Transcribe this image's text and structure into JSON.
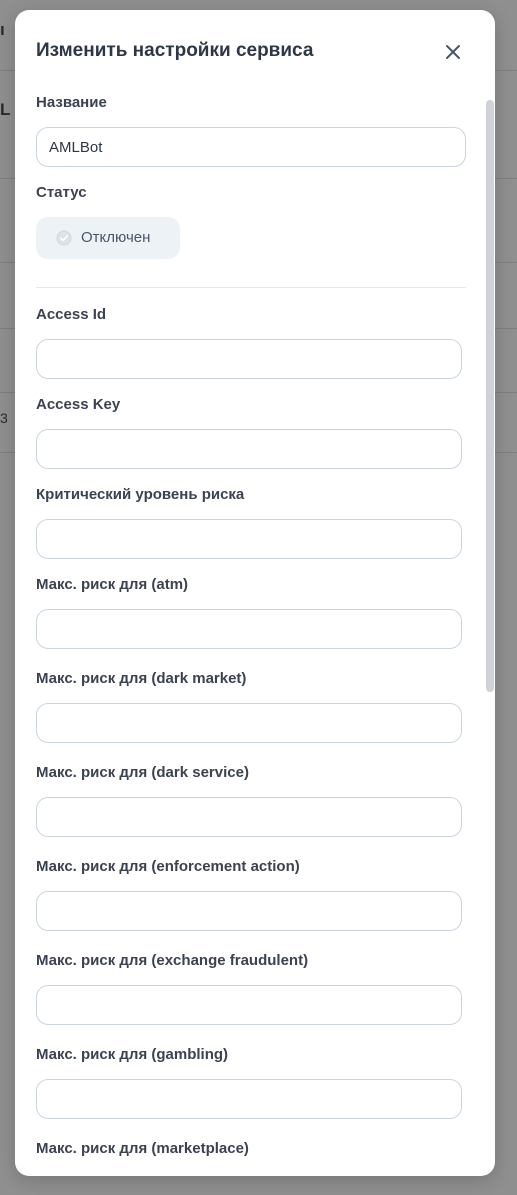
{
  "modal": {
    "title": "Изменить настройки сервиса"
  },
  "form": {
    "name": {
      "label": "Название",
      "value": "AMLBot"
    },
    "status": {
      "label": "Статус",
      "value": "Отключен"
    },
    "fields": [
      {
        "label": "Access Id",
        "value": ""
      },
      {
        "label": "Access Key",
        "value": ""
      },
      {
        "label": "Критический уровень риска",
        "value": ""
      },
      {
        "label": "Макс. риск для (atm)",
        "value": ""
      },
      {
        "label": "Макс. риск для (dark market)",
        "value": ""
      },
      {
        "label": "Макс. риск для (dark service)",
        "value": ""
      },
      {
        "label": "Макс. риск для (enforcement action)",
        "value": ""
      },
      {
        "label": "Макс. риск для (exchange fraudulent)",
        "value": ""
      },
      {
        "label": "Макс. риск для (gambling)",
        "value": ""
      },
      {
        "label": "Макс. риск для (marketplace)",
        "value": ""
      }
    ]
  },
  "background": {
    "fragments": [
      "ı",
      "L c",
      "3"
    ]
  },
  "colors": {
    "overlay": "#8f8f8f",
    "title": "#2d3748",
    "label": "#3b4251",
    "input_border": "#cbd5e0",
    "status_bg": "#edf2f7"
  },
  "icons": {
    "close": "close-icon",
    "status": "check-circle-icon"
  }
}
